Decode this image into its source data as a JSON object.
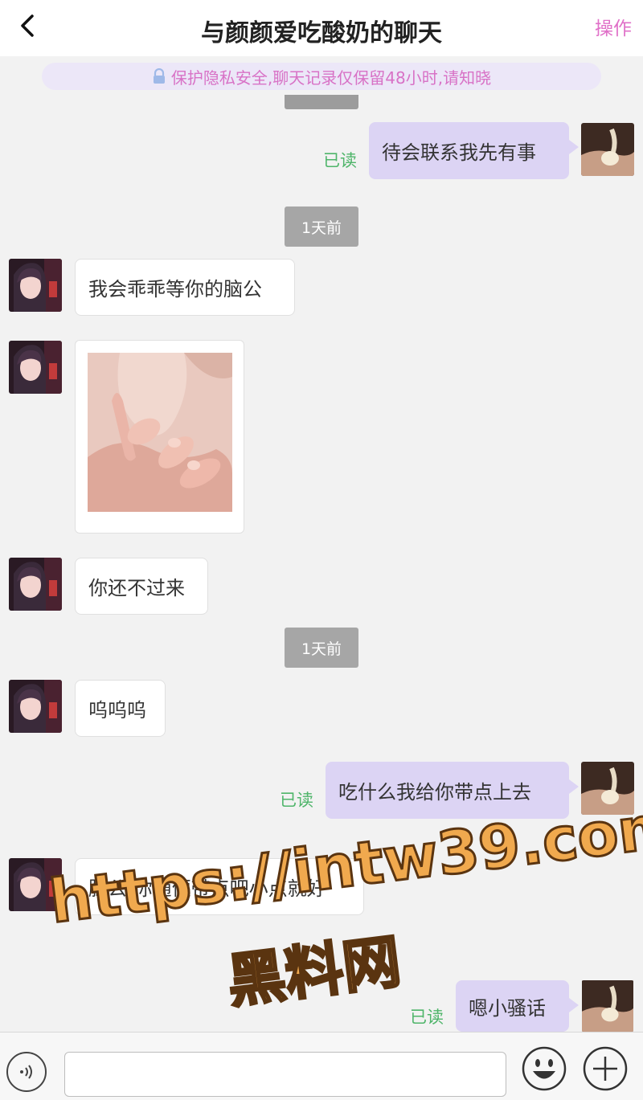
{
  "header": {
    "title": "与颜颜爱吃酸奶的聊天",
    "action_label": "操作"
  },
  "notice": {
    "text": "保护隐私安全,聊天记录仅保留48小时,请知晓"
  },
  "messages": [
    {
      "from": "me",
      "text": "待会联系我先有事",
      "status": "已读"
    },
    {
      "type": "time",
      "text": "1天前"
    },
    {
      "from": "her",
      "text": "我会乖乖等你的脑公"
    },
    {
      "from": "her",
      "type": "image"
    },
    {
      "from": "her",
      "text": "你还不过来"
    },
    {
      "type": "time",
      "text": "1天前"
    },
    {
      "from": "her",
      "text": "呜呜呜"
    },
    {
      "from": "me",
      "text": "吃什么我给你带点上去",
      "status": "已读"
    },
    {
      "from": "her",
      "text": "脑公 你随便带点吧小点就好"
    },
    {
      "from": "me",
      "text": "嗯小骚话",
      "status": "已读"
    }
  ],
  "watermark": {
    "line1": "https://intw39.com",
    "line2": "黑料网"
  },
  "input_bar": {
    "placeholder": ""
  },
  "colors": {
    "accent": "#e070c8",
    "outgoing_bubble": "#dcd4f4",
    "read_status": "#4fb56a",
    "notice_bg": "#ece7f8"
  }
}
